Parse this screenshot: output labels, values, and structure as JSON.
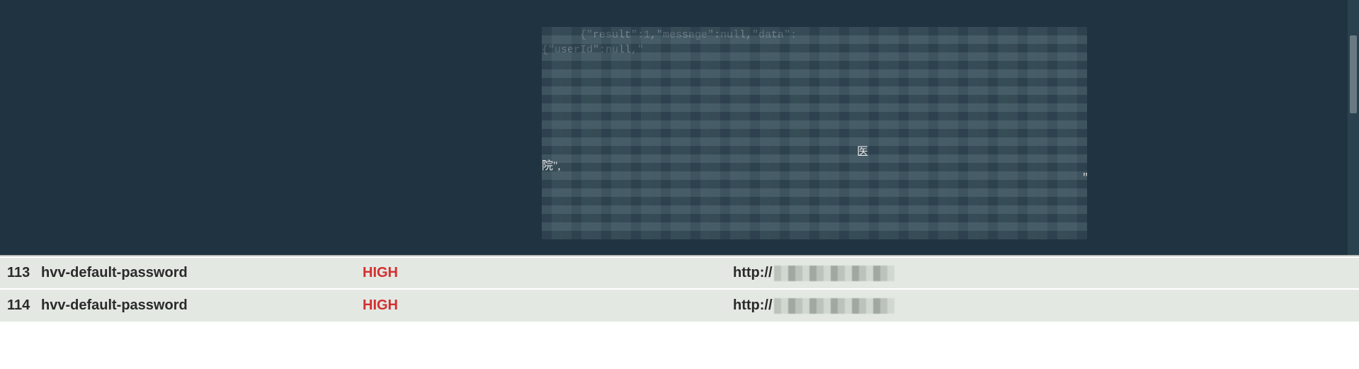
{
  "detail": {
    "raw_line1": "{\"result\":1,\"message\":null,\"data\":",
    "raw_line2": "{\"userId\":null,\"",
    "cjk1": "医",
    "cjk2": "院\",",
    "quote_end": "\""
  },
  "results": [
    {
      "id": "113",
      "name": "hvv-default-password",
      "severity": "HIGH",
      "url_prefix": "http://"
    },
    {
      "id": "114",
      "name": "hvv-default-password",
      "severity": "HIGH",
      "url_prefix": "http://"
    }
  ],
  "colors": {
    "code_bg": "#1f3440",
    "row_bg": "#e3e8e3",
    "severity_high": "#d32f2f"
  }
}
